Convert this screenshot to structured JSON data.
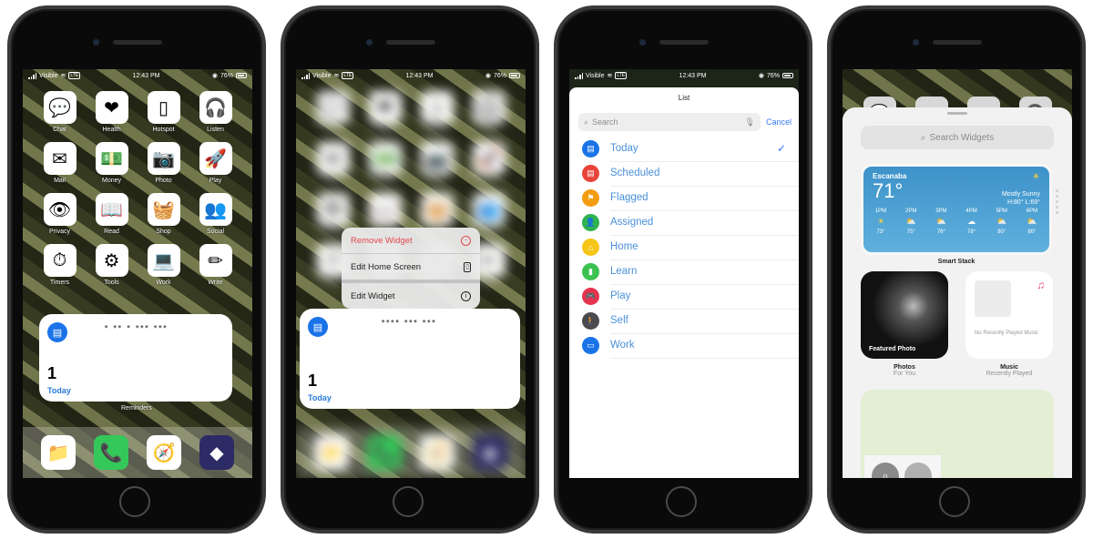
{
  "status_bar": {
    "carrier": "Visible",
    "network_badge": "LTE",
    "time": "12:43 PM",
    "battery": "76%"
  },
  "phone1": {
    "apps": [
      {
        "label": "Chat",
        "icon": "chat-bubbles-icon",
        "glyph": "💬"
      },
      {
        "label": "Health",
        "icon": "heart-icon",
        "glyph": "❤"
      },
      {
        "label": "Hotspot",
        "icon": "phone-outline-icon",
        "glyph": "▯"
      },
      {
        "label": "Listen",
        "icon": "airpods-icon",
        "glyph": "🎧"
      },
      {
        "label": "Mail",
        "icon": "envelope-icon",
        "glyph": "✉"
      },
      {
        "label": "Money",
        "icon": "cash-icon",
        "glyph": "💵"
      },
      {
        "label": "Photo",
        "icon": "camera-icon",
        "glyph": "📷"
      },
      {
        "label": "Play",
        "icon": "rocket-icon",
        "glyph": "🚀"
      },
      {
        "label": "Privacy",
        "icon": "eye-icon",
        "glyph": "👁"
      },
      {
        "label": "Read",
        "icon": "book-icon",
        "glyph": "📖"
      },
      {
        "label": "Shop",
        "icon": "basket-icon",
        "glyph": "🧺"
      },
      {
        "label": "Social",
        "icon": "people-icon",
        "glyph": "👥"
      },
      {
        "label": "Timers",
        "icon": "stopwatch-icon",
        "glyph": "⏱"
      },
      {
        "label": "Tools",
        "icon": "toggles-icon",
        "glyph": "⚙"
      },
      {
        "label": "Work",
        "icon": "laptop-icon",
        "glyph": "💻"
      },
      {
        "label": "Write",
        "icon": "pencil-icon",
        "glyph": "✏"
      }
    ],
    "widget": {
      "count": "1",
      "list_name": "Today",
      "caption": "Reminders",
      "redacted_text": "• ••  •  ••• •••"
    },
    "dock": [
      {
        "icon": "files-folder-icon",
        "glyph": "📁",
        "color": "#ffffff"
      },
      {
        "icon": "phone-call-icon",
        "glyph": "📞",
        "color": "#34c759"
      },
      {
        "icon": "safari-compass-icon",
        "glyph": "🧭",
        "color": "#ffffff"
      },
      {
        "icon": "shortcuts-icon",
        "glyph": "◆",
        "color": "#2c2b66"
      }
    ]
  },
  "phone2": {
    "context_menu": [
      {
        "label": "Remove Widget",
        "icon": "minus-circle-icon",
        "glyph": "−"
      },
      {
        "label": "Edit Home Screen",
        "icon": "phone-apps-icon",
        "glyph": "▯"
      },
      {
        "label": "Edit Widget",
        "icon": "info-circle-icon",
        "glyph": "i"
      }
    ],
    "widget": {
      "count": "1",
      "list_name": "Today",
      "redacted_text": "•••• ••• •••"
    }
  },
  "phone3": {
    "sheet_title": "List",
    "search": {
      "placeholder": "Search",
      "cancel_label": "Cancel"
    },
    "lists": [
      {
        "label": "Today",
        "color": "#1a73e8",
        "icon": "calendar-icon",
        "glyph": "▤",
        "selected": true
      },
      {
        "label": "Scheduled",
        "color": "#e8443a",
        "icon": "calendar-icon",
        "glyph": "▤",
        "selected": false
      },
      {
        "label": "Flagged",
        "color": "#f39c12",
        "icon": "flag-icon",
        "glyph": "⚑",
        "selected": false
      },
      {
        "label": "Assigned",
        "color": "#2eb34f",
        "icon": "person-icon",
        "glyph": "👤",
        "selected": false
      },
      {
        "label": "Home",
        "color": "#f5c518",
        "icon": "house-icon",
        "glyph": "⌂",
        "selected": false
      },
      {
        "label": "Learn",
        "color": "#3cc251",
        "icon": "bookmark-icon",
        "glyph": "▮",
        "selected": false
      },
      {
        "label": "Play",
        "color": "#e8334f",
        "icon": "gamepad-icon",
        "glyph": "🎮",
        "selected": false
      },
      {
        "label": "Self",
        "color": "#4a4a4f",
        "icon": "figure-icon",
        "glyph": "🚶",
        "selected": false
      },
      {
        "label": "Work",
        "color": "#1a73e8",
        "icon": "monitor-icon",
        "glyph": "▭",
        "selected": false
      }
    ],
    "check_glyph": "✓"
  },
  "phone4": {
    "search_placeholder": "Search Widgets",
    "weather": {
      "city": "Escanaba",
      "temp": "71°",
      "condition": "Mostly Sunny",
      "hi_lo": "H:80° L:69°",
      "hours": [
        {
          "time": "1PM",
          "icon": "sun-icon",
          "glyph": "☀",
          "temp": "73°"
        },
        {
          "time": "2PM",
          "icon": "partly-cloudy-icon",
          "glyph": "⛅",
          "temp": "75°"
        },
        {
          "time": "3PM",
          "icon": "partly-cloudy-icon",
          "glyph": "⛅",
          "temp": "76°"
        },
        {
          "time": "4PM",
          "icon": "cloud-icon",
          "glyph": "☁",
          "temp": "78°"
        },
        {
          "time": "5PM",
          "icon": "partly-cloudy-icon",
          "glyph": "⛅",
          "temp": "80°"
        },
        {
          "time": "6PM",
          "icon": "partly-cloudy-icon",
          "glyph": "⛅",
          "temp": "80°"
        }
      ],
      "caption": "Smart Stack"
    },
    "photos": {
      "overlay": "Featured Photo",
      "title": "Photos",
      "subtitle": "For You"
    },
    "music": {
      "empty_text": "No Recently Played Music",
      "title": "Music",
      "subtitle": "Recently Played"
    }
  }
}
